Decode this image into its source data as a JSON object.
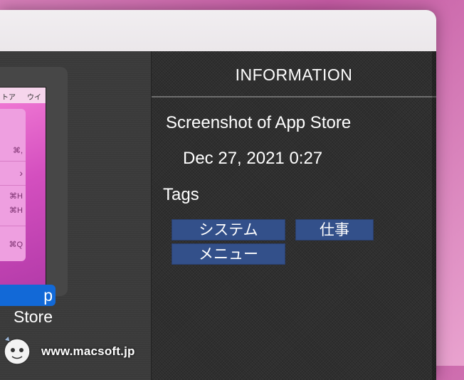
{
  "thumbnail": {
    "menubar": [
      "トア",
      "ウイ"
    ],
    "menu_shortcuts": [
      "⌘,",
      "›",
      "⌘H",
      "⌘H",
      "⌘Q"
    ],
    "label": "p Store"
  },
  "brand": {
    "text": "www.macsoft.jp",
    "mascot_icon": "mascot-face-icon"
  },
  "info": {
    "header": "INFORMATION",
    "title": "Screenshot of App Store",
    "date": "Dec 27, 2021 0:27",
    "tags_label": "Tags",
    "tags": [
      "システム",
      "仕事",
      "メニュー"
    ]
  },
  "colors": {
    "tag_bg": "#33508a",
    "selection": "#1269d7",
    "panel": "#2f2f2f"
  }
}
